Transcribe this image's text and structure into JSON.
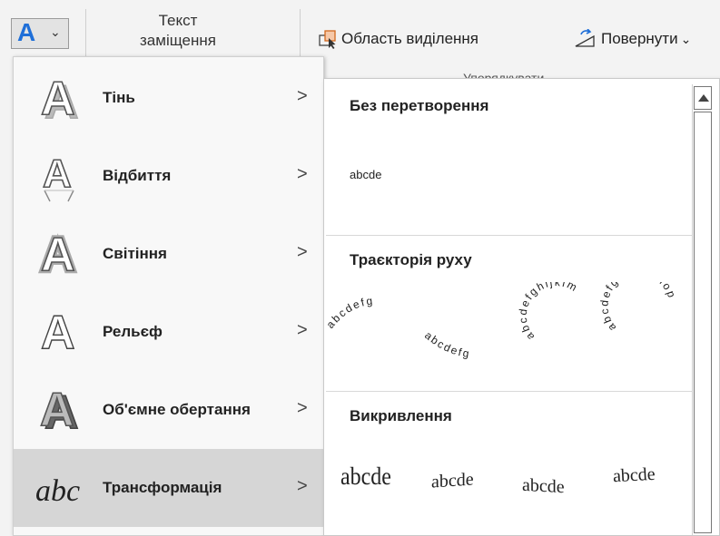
{
  "ribbon": {
    "text_effects_button": "A",
    "alt_text_line1": "Текст",
    "alt_text_line2": "заміщення",
    "selection_pane": "Область виділення",
    "rotate": "Повернути",
    "group_label": "Упорядкувати"
  },
  "menu": {
    "items": [
      {
        "label": "Тінь",
        "icon": "shadow-a-icon"
      },
      {
        "label": "Відбиття",
        "icon": "reflection-a-icon"
      },
      {
        "label": "Світіння",
        "icon": "glow-a-icon"
      },
      {
        "label": "Рельєф",
        "icon": "bevel-a-icon"
      },
      {
        "label": "Об'ємне обертання",
        "icon": "3d-rotation-a-icon"
      },
      {
        "label": "Трансформація",
        "icon": "transform-abc-icon"
      }
    ],
    "arrow": ">"
  },
  "gallery": {
    "no_transform_title": "Без перетворення",
    "no_transform_sample": "abcde",
    "follow_path_title": "Траєкторія руху",
    "follow_path_samples": [
      "abcdefg",
      "abcdefg",
      "abcdefghijklm",
      "abcdefghijklmnop"
    ],
    "warp_title": "Викривлення",
    "warp_samples": [
      "abcde",
      "abcde",
      "abcde",
      "abcde"
    ]
  }
}
